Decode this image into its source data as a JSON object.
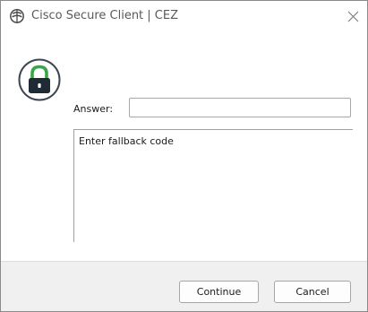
{
  "window": {
    "title": "Cisco Secure Client | CEZ",
    "title_icon": "cisco-secure-client-icon",
    "close_icon": "close-icon"
  },
  "prompt": {
    "lock_icon": "lock-icon",
    "answer_label": "Answer:",
    "answer_value": "",
    "message": "Enter fallback code"
  },
  "buttons": {
    "continue_label": "Continue",
    "cancel_label": "Cancel"
  },
  "colors": {
    "lock_shackle": "#3aa54a",
    "lock_body": "#1f2a35",
    "footer_bg": "#f0f0f0"
  }
}
